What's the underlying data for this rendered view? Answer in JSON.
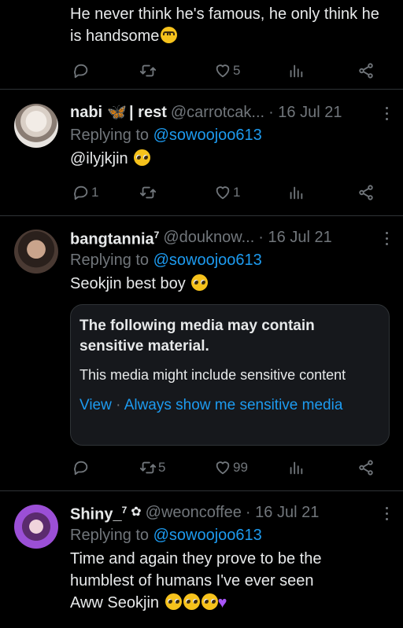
{
  "tweets": [
    {
      "text": "He never think he's famous, he only think he is handsome",
      "likes": "5"
    },
    {
      "name": "nabi",
      "name_suffix": "| rest",
      "handle": "@carrotcak...",
      "date": "· 16 Jul 21",
      "replying_prefix": "Replying to",
      "replying_to": "@sowoojoo613",
      "text": "@ilyjkjin",
      "replies": "1",
      "likes": "1"
    },
    {
      "name": "bangtannia",
      "name_sup": "7",
      "handle": "@douknow...",
      "date": "· 16 Jul 21",
      "replying_prefix": "Replying to",
      "replying_to": "@sowoojoo613",
      "text": "Seokjin best boy",
      "sensitive": {
        "title": "The following media may contain sensitive material.",
        "body": "This media might include sensitive content",
        "view": "View",
        "separator": "·",
        "always_show": "Always show me sensitive media"
      },
      "retweets": "5",
      "likes": "99"
    },
    {
      "name": "Shiny_",
      "name_sup": "7",
      "handle": "@weoncoffee",
      "date": "· 16 Jul 21",
      "replying_prefix": "Replying to",
      "replying_to": "@sowoojoo613",
      "text_line1": "Time and again they prove to be the",
      "text_line2": "humblest of humans I've ever seen",
      "text_line3": "Aww Seokjin"
    }
  ],
  "colors": {
    "background": "#000000",
    "text": "#e7e9ea",
    "muted": "#71767b",
    "link": "#1d9bf0",
    "divider": "#2f3336"
  }
}
